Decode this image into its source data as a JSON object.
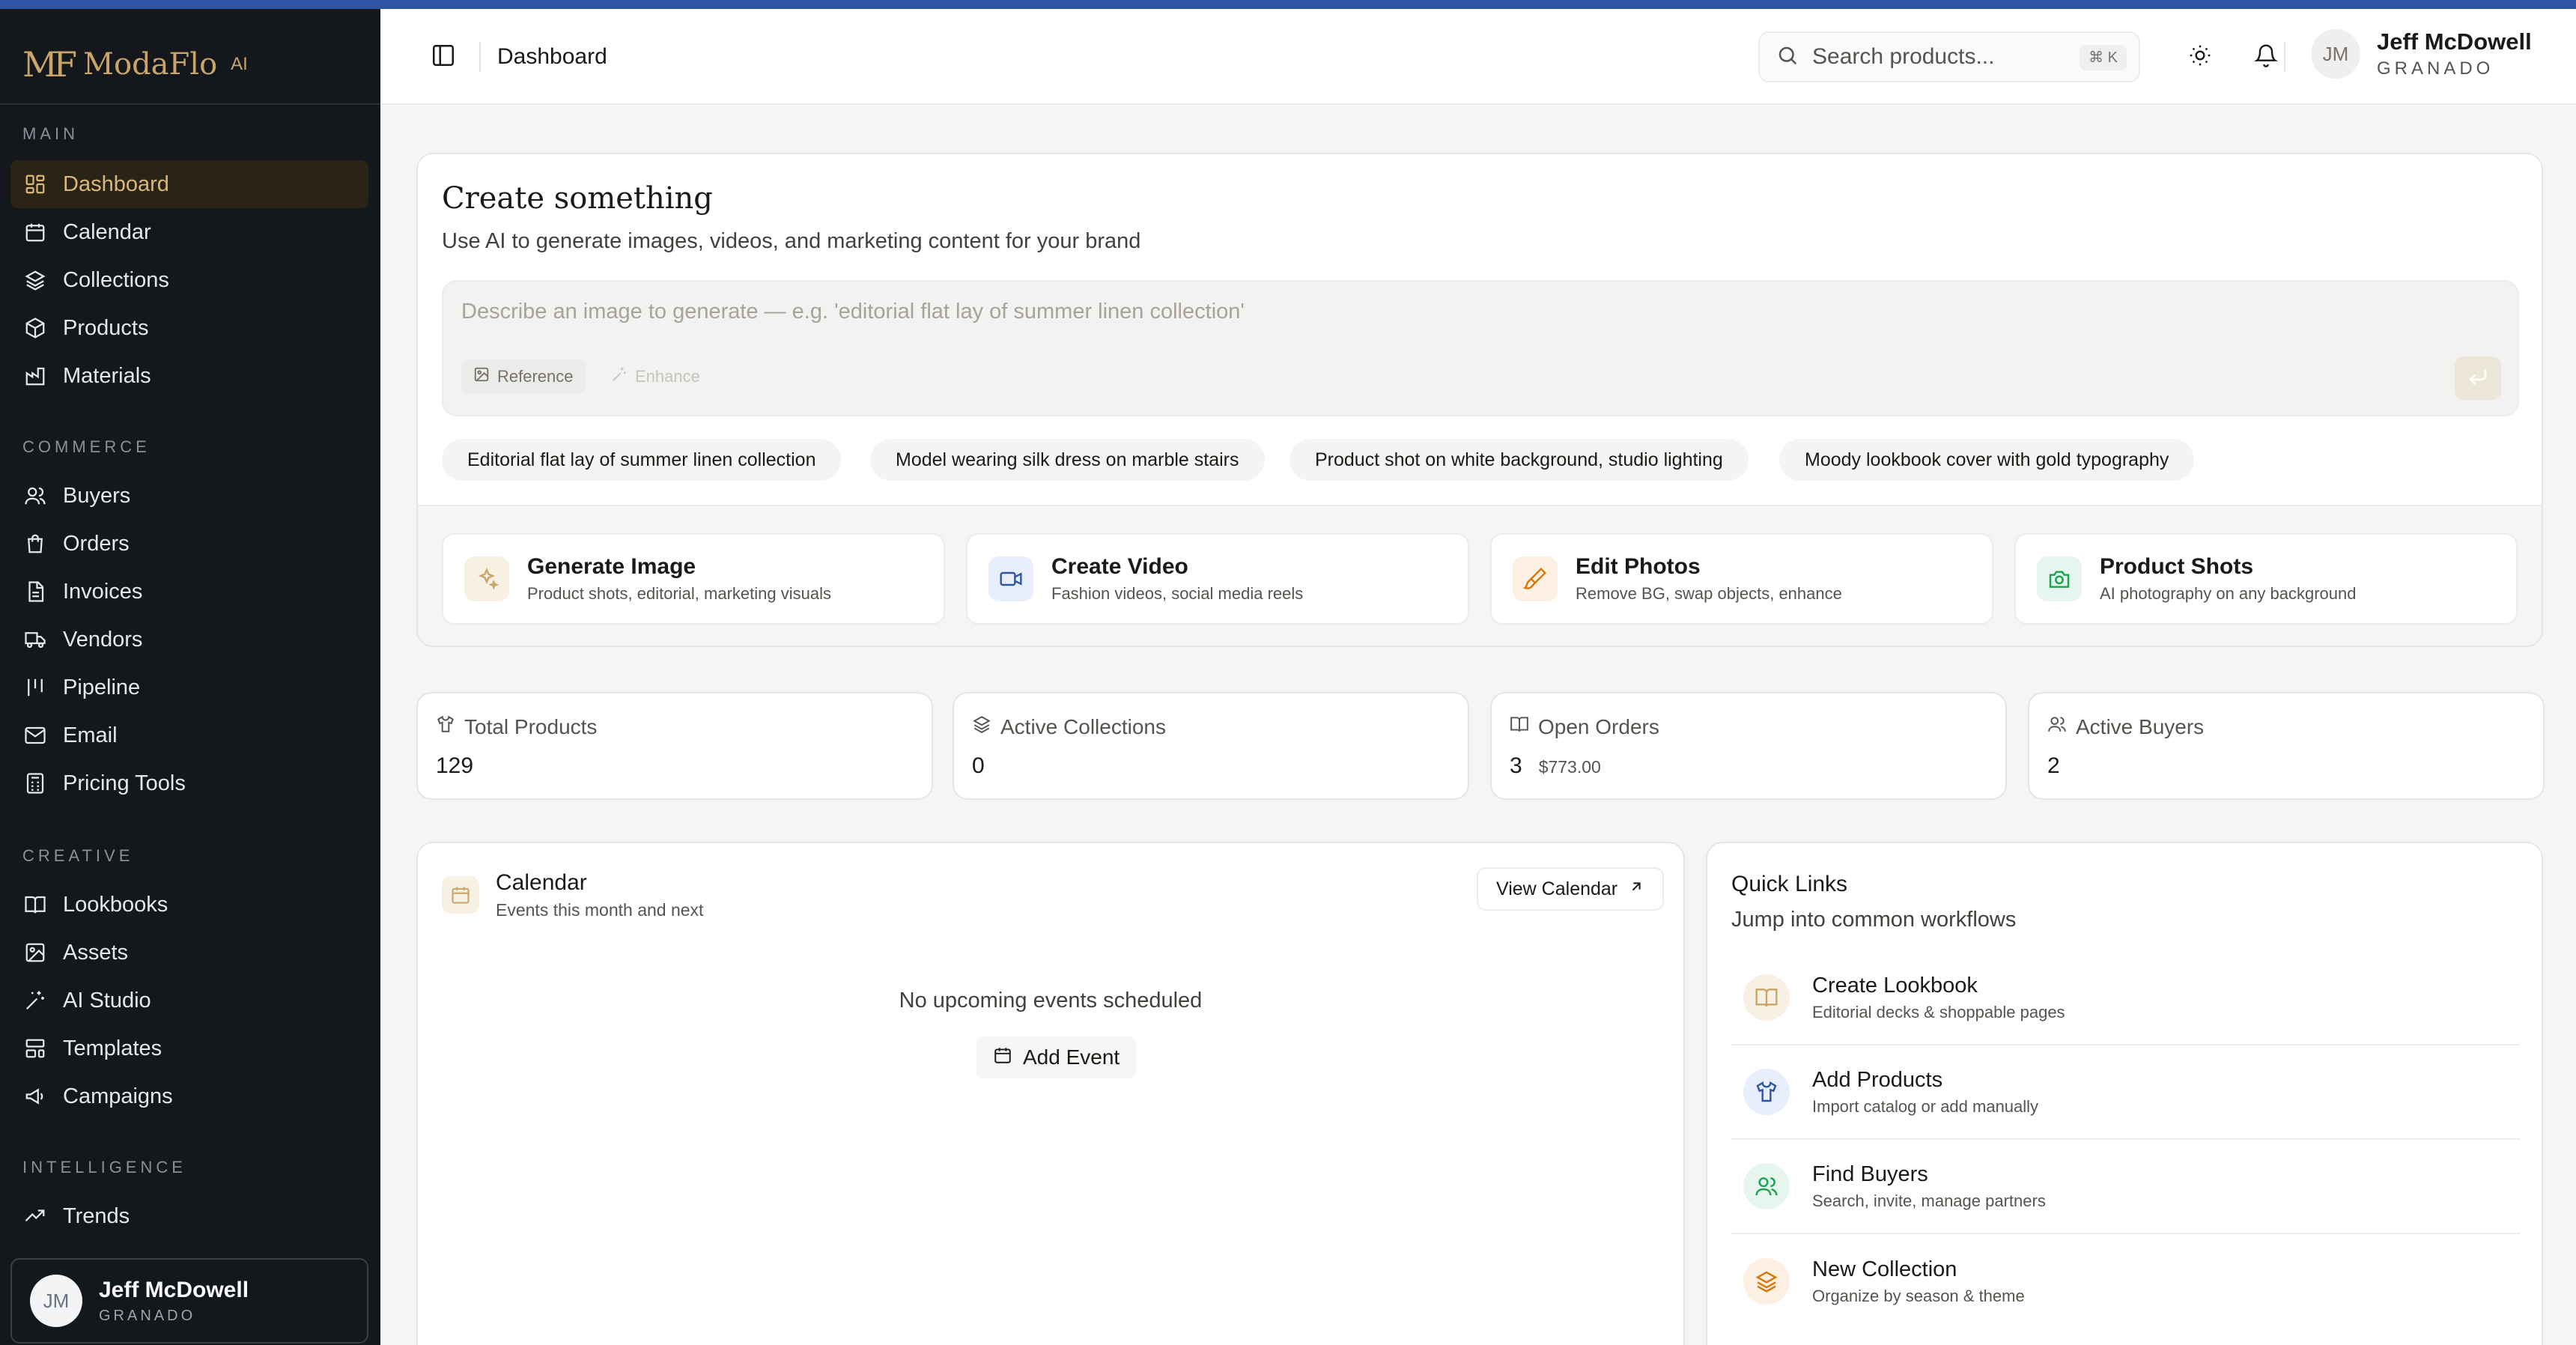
{
  "brand": {
    "mark": "MF",
    "name": "ModaFlo",
    "suffix": "AI"
  },
  "sidebar": {
    "sections": [
      {
        "label": "MAIN",
        "items": [
          "Dashboard",
          "Calendar",
          "Collections",
          "Products",
          "Materials"
        ]
      },
      {
        "label": "COMMERCE",
        "items": [
          "Buyers",
          "Orders",
          "Invoices",
          "Vendors",
          "Pipeline",
          "Email",
          "Pricing Tools"
        ]
      },
      {
        "label": "CREATIVE",
        "items": [
          "Lookbooks",
          "Assets",
          "AI Studio",
          "Templates",
          "Campaigns"
        ]
      },
      {
        "label": "INTELLIGENCE",
        "items": [
          "Trends"
        ]
      }
    ],
    "active_item": "Dashboard",
    "user": {
      "initials": "JM",
      "name": "Jeff McDowell",
      "org": "GRANADO"
    }
  },
  "header": {
    "breadcrumb": "Dashboard",
    "search_placeholder": "Search products...",
    "search_shortcut": "⌘ K",
    "user": {
      "initials": "JM",
      "name": "Jeff McDowell",
      "org": "GRANADO"
    }
  },
  "create": {
    "title": "Create something",
    "subtitle": "Use AI to generate images, videos, and marketing content for your brand",
    "prompt_placeholder": "Describe an image to generate — e.g. 'editorial flat lay of summer linen collection'",
    "reference_label": "Reference",
    "enhance_label": "Enhance",
    "suggestions": [
      "Editorial flat lay of summer linen collection",
      "Model wearing silk dress on marble stairs",
      "Product shot on white background, studio lighting",
      "Moody lookbook cover with gold typography"
    ],
    "tools": [
      {
        "title": "Generate Image",
        "desc": "Product shots, editorial, marketing visuals"
      },
      {
        "title": "Create Video",
        "desc": "Fashion videos, social media reels"
      },
      {
        "title": "Edit Photos",
        "desc": "Remove BG, swap objects, enhance"
      },
      {
        "title": "Product Shots",
        "desc": "AI photography on any background"
      }
    ]
  },
  "stats": [
    {
      "label": "Total Products",
      "value": "129",
      "extra": ""
    },
    {
      "label": "Active Collections",
      "value": "0",
      "extra": ""
    },
    {
      "label": "Open Orders",
      "value": "3",
      "extra": "$773.00"
    },
    {
      "label": "Active Buyers",
      "value": "2",
      "extra": ""
    }
  ],
  "calendar": {
    "title": "Calendar",
    "subtitle": "Events this month and next",
    "view_button": "View Calendar",
    "empty": "No upcoming events scheduled",
    "add_button": "Add Event"
  },
  "quick_links": {
    "title": "Quick Links",
    "subtitle": "Jump into common workflows",
    "items": [
      {
        "title": "Create Lookbook",
        "desc": "Editorial decks & shoppable pages"
      },
      {
        "title": "Add Products",
        "desc": "Import catalog or add manually"
      },
      {
        "title": "Find Buyers",
        "desc": "Search, invite, manage partners"
      },
      {
        "title": "New Collection",
        "desc": "Organize by season & theme"
      }
    ]
  },
  "colors": {
    "sidebar_bg": "#14171c",
    "accent_gold": "#c9a56a",
    "top_bar": "#2e55a3"
  }
}
